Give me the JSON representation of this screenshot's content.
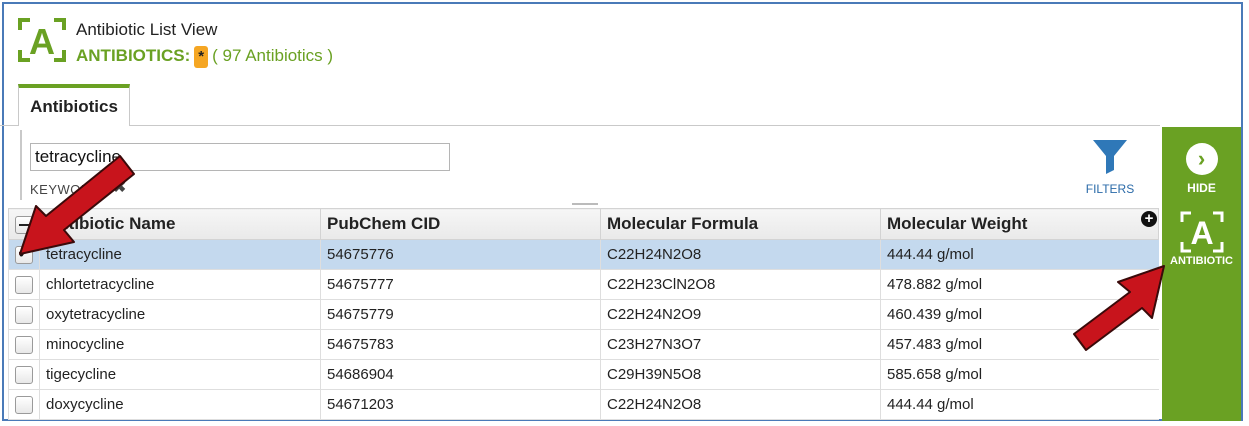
{
  "header": {
    "title": "Antibiotic List View",
    "collection_label": "ANTIBIOTICS:",
    "badge": "*",
    "count_text": "( 97 Antibiotics )"
  },
  "tabs": [
    {
      "label": "Antibiotics",
      "active": true
    }
  ],
  "search": {
    "value": "tetracycline",
    "keyword_label": "KEYWORD",
    "clear_glyph": "✖"
  },
  "filters": {
    "label": "FILTERS"
  },
  "table": {
    "columns": [
      "Antibiotic Name",
      "PubChem CID",
      "Molecular Formula",
      "Molecular Weight"
    ],
    "rows": [
      {
        "name": "tetracycline",
        "cid": "54675776",
        "formula": "C22H24N2O8",
        "weight": "444.44 g/mol",
        "checked": true
      },
      {
        "name": "chlortetracycline",
        "cid": "54675777",
        "formula": "C22H23ClN2O8",
        "weight": "478.882 g/mol",
        "checked": false
      },
      {
        "name": "oxytetracycline",
        "cid": "54675779",
        "formula": "C22H24N2O9",
        "weight": "460.439 g/mol",
        "checked": false
      },
      {
        "name": "minocycline",
        "cid": "54675783",
        "formula": "C23H27N3O7",
        "weight": "457.483 g/mol",
        "checked": false
      },
      {
        "name": "tigecycline",
        "cid": "54686904",
        "formula": "C29H39N5O8",
        "weight": "585.658 g/mol",
        "checked": false
      },
      {
        "name": "doxycycline",
        "cid": "54671203",
        "formula": "C22H24N2O8",
        "weight": "444.44 g/mol",
        "checked": false
      }
    ]
  },
  "side_panel": {
    "hide_label": "HIDE",
    "antibiotic_label": "ANTIBIOTIC",
    "logo_letter": "A"
  },
  "colors": {
    "brand_green": "#6aa123",
    "selected_row": "#c4d9ee",
    "frame_blue": "#4a7ab8",
    "arrow_red": "#c8141c",
    "badge_orange": "#f5a623"
  },
  "icons": {
    "logo": "antibiotic-a-logo-icon",
    "filters": "funnel-icon",
    "hide": "chevron-right-circle-icon",
    "add_column": "plus-circle-icon"
  }
}
